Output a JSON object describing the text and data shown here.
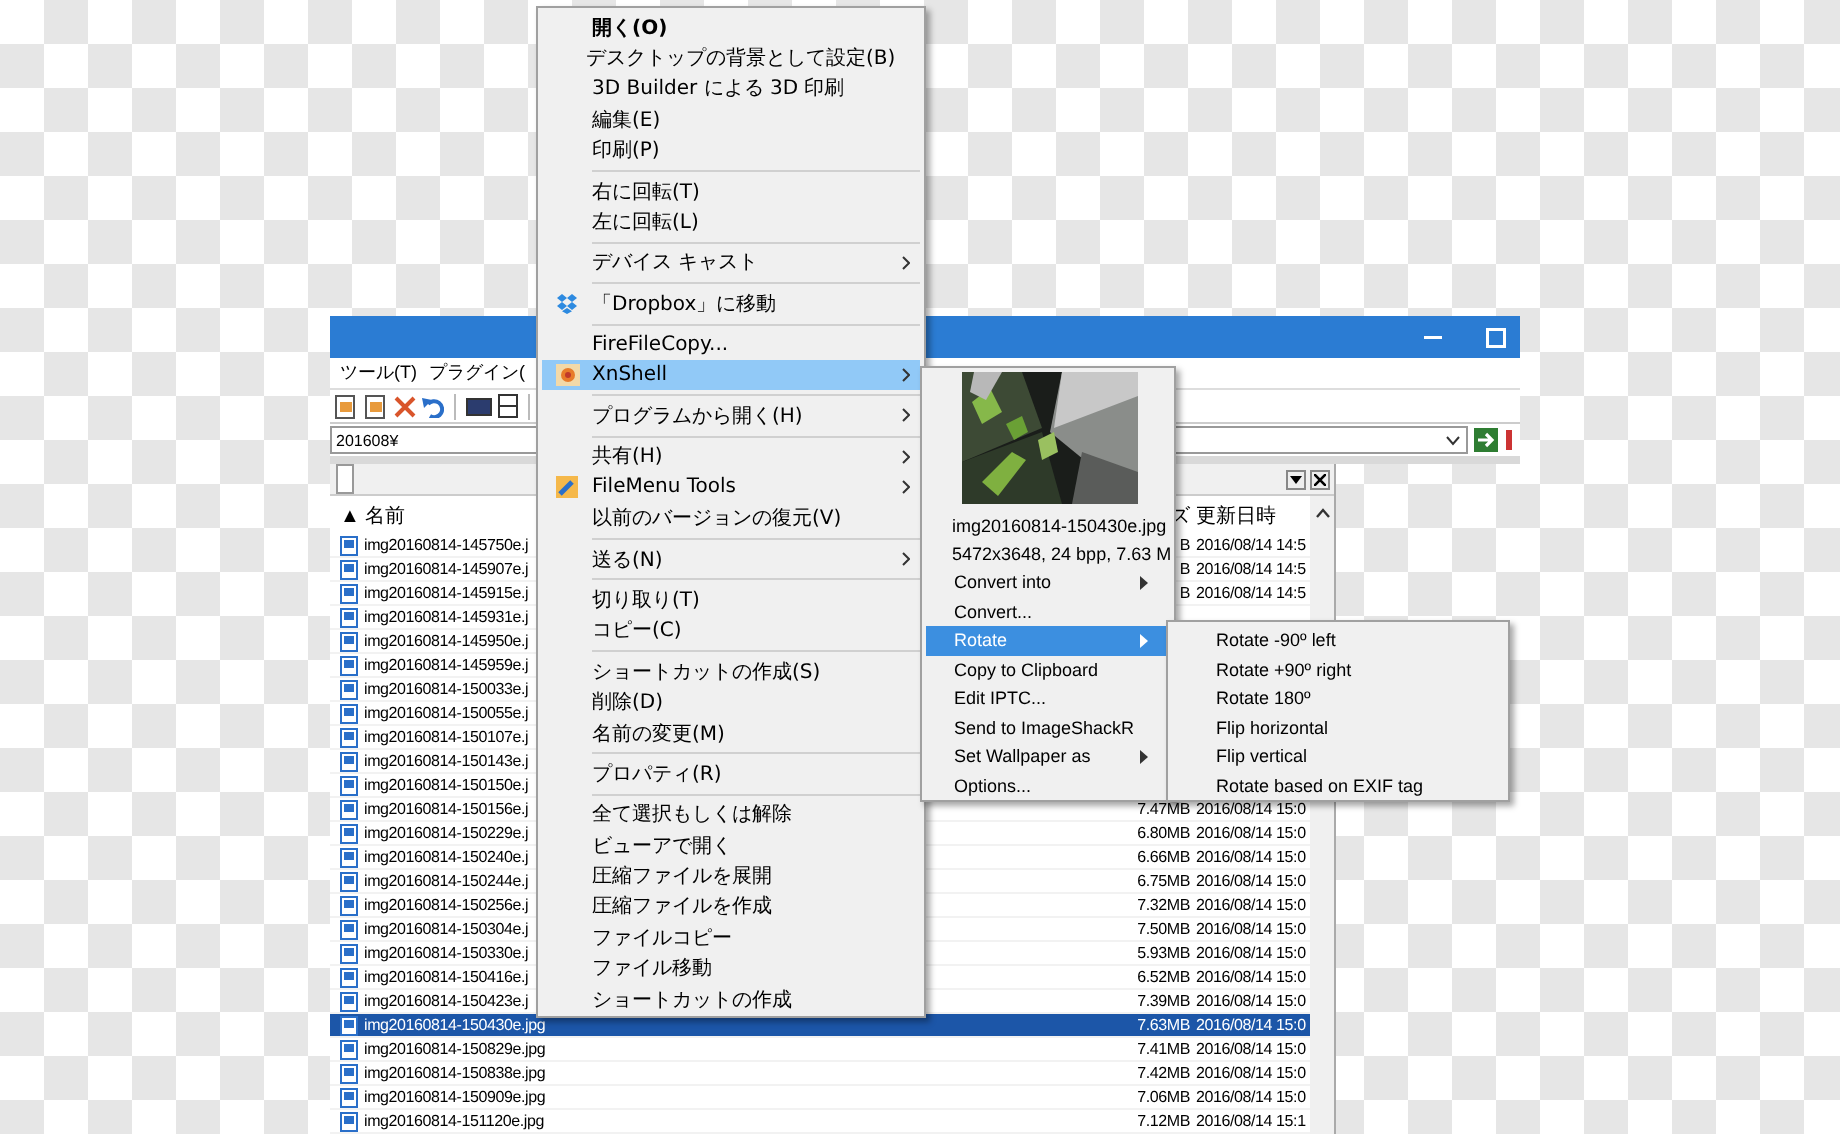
{
  "explorer": {
    "menu_bar": [
      "ツール(T)",
      "プラグイン("
    ],
    "address": "201608¥",
    "columns": {
      "sort_mark": "▲",
      "name": "名前",
      "size": "ズ",
      "modified": "更新日時"
    },
    "rows": [
      {
        "name": "img20160814-145750e.j",
        "size": "B",
        "modified": "2016/08/14 14:5",
        "selected": false
      },
      {
        "name": "img20160814-145907e.j",
        "size": "B",
        "modified": "2016/08/14 14:5",
        "selected": false
      },
      {
        "name": "img20160814-145915e.j",
        "size": "B",
        "modified": "2016/08/14 14:5",
        "selected": false
      },
      {
        "name": "img20160814-145931e.j",
        "selected": false
      },
      {
        "name": "img20160814-145950e.j",
        "selected": false
      },
      {
        "name": "img20160814-145959e.j",
        "selected": false
      },
      {
        "name": "img20160814-150033e.j",
        "selected": false
      },
      {
        "name": "img20160814-150055e.j",
        "selected": false
      },
      {
        "name": "img20160814-150107e.j",
        "selected": false
      },
      {
        "name": "img20160814-150143e.j",
        "selected": false
      },
      {
        "name": "img20160814-150150e.j",
        "selected": false
      },
      {
        "name": "img20160814-150156e.j",
        "size": "7.47MB",
        "modified": "2016/08/14 15:0",
        "selected": false
      },
      {
        "name": "img20160814-150229e.j",
        "size": "6.80MB",
        "modified": "2016/08/14 15:0",
        "selected": false
      },
      {
        "name": "img20160814-150240e.j",
        "size": "6.66MB",
        "modified": "2016/08/14 15:0",
        "selected": false
      },
      {
        "name": "img20160814-150244e.j",
        "size": "6.75MB",
        "modified": "2016/08/14 15:0",
        "selected": false
      },
      {
        "name": "img20160814-150256e.j",
        "size": "7.32MB",
        "modified": "2016/08/14 15:0",
        "selected": false
      },
      {
        "name": "img20160814-150304e.j",
        "size": "7.50MB",
        "modified": "2016/08/14 15:0",
        "selected": false
      },
      {
        "name": "img20160814-150330e.j",
        "size": "5.93MB",
        "modified": "2016/08/14 15:0",
        "selected": false
      },
      {
        "name": "img20160814-150416e.j",
        "size": "6.52MB",
        "modified": "2016/08/14 15:0",
        "selected": false
      },
      {
        "name": "img20160814-150423e.j",
        "size": "7.39MB",
        "modified": "2016/08/14 15:0",
        "selected": false
      },
      {
        "name": "img20160814-150430e.jpg",
        "size": "7.63MB",
        "modified": "2016/08/14 15:0",
        "selected": true
      },
      {
        "name": "img20160814-150829e.jpg",
        "size": "7.41MB",
        "modified": "2016/08/14 15:0",
        "selected": false
      },
      {
        "name": "img20160814-150838e.jpg",
        "size": "7.42MB",
        "modified": "2016/08/14 15:0",
        "selected": false
      },
      {
        "name": "img20160814-150909e.jpg",
        "size": "7.06MB",
        "modified": "2016/08/14 15:0",
        "selected": false
      },
      {
        "name": "img20160814-151120e.jpg",
        "size": "7.12MB",
        "modified": "2016/08/14 15:1",
        "selected": false
      }
    ]
  },
  "context_menu": {
    "items": [
      {
        "kind": "item",
        "label": "開く(O)",
        "bold": true,
        "submenu": false,
        "selected": false
      },
      {
        "kind": "item",
        "label": "デスクトップの背景として設定(B)",
        "bold": false,
        "submenu": false,
        "selected": false
      },
      {
        "kind": "item",
        "label": "3D Builder による 3D 印刷",
        "bold": false,
        "submenu": false,
        "selected": false
      },
      {
        "kind": "item",
        "label": "編集(E)",
        "bold": false,
        "submenu": false,
        "selected": false
      },
      {
        "kind": "item",
        "label": "印刷(P)",
        "bold": false,
        "submenu": false,
        "selected": false
      },
      {
        "kind": "separator"
      },
      {
        "kind": "item",
        "label": "右に回転(T)",
        "bold": false,
        "submenu": false,
        "selected": false
      },
      {
        "kind": "item",
        "label": "左に回転(L)",
        "bold": false,
        "submenu": false,
        "selected": false
      },
      {
        "kind": "separator"
      },
      {
        "kind": "item",
        "label": "デバイス キャスト",
        "bold": false,
        "submenu": true,
        "selected": false
      },
      {
        "kind": "separator"
      },
      {
        "kind": "item",
        "label": "「Dropbox」に移動",
        "bold": false,
        "submenu": false,
        "selected": false
      },
      {
        "kind": "separator"
      },
      {
        "kind": "item",
        "label": "FireFileCopy...",
        "bold": false,
        "submenu": false,
        "selected": false
      },
      {
        "kind": "item",
        "label": "XnShell",
        "bold": false,
        "submenu": true,
        "selected": true
      },
      {
        "kind": "separator"
      },
      {
        "kind": "item",
        "label": "プログラムから開く(H)",
        "bold": false,
        "submenu": true,
        "selected": false
      },
      {
        "kind": "separator"
      },
      {
        "kind": "item",
        "label": "共有(H)",
        "bold": false,
        "submenu": true,
        "selected": false
      },
      {
        "kind": "item",
        "label": "FileMenu Tools",
        "bold": false,
        "submenu": true,
        "selected": false
      },
      {
        "kind": "item",
        "label": "以前のバージョンの復元(V)",
        "bold": false,
        "submenu": false,
        "selected": false
      },
      {
        "kind": "separator"
      },
      {
        "kind": "item",
        "label": "送る(N)",
        "bold": false,
        "submenu": true,
        "selected": false
      },
      {
        "kind": "separator"
      },
      {
        "kind": "item",
        "label": "切り取り(T)",
        "bold": false,
        "submenu": false,
        "selected": false
      },
      {
        "kind": "item",
        "label": "コピー(C)",
        "bold": false,
        "submenu": false,
        "selected": false
      },
      {
        "kind": "separator"
      },
      {
        "kind": "item",
        "label": "ショートカットの作成(S)",
        "bold": false,
        "submenu": false,
        "selected": false
      },
      {
        "kind": "item",
        "label": "削除(D)",
        "bold": false,
        "submenu": false,
        "selected": false
      },
      {
        "kind": "item",
        "label": "名前の変更(M)",
        "bold": false,
        "submenu": false,
        "selected": false
      },
      {
        "kind": "separator"
      },
      {
        "kind": "item",
        "label": "プロパティ(R)",
        "bold": false,
        "submenu": false,
        "selected": false
      },
      {
        "kind": "separator"
      },
      {
        "kind": "item",
        "label": "全て選択もしくは解除",
        "bold": false,
        "submenu": false,
        "selected": false
      },
      {
        "kind": "item",
        "label": "ビューアで開く",
        "bold": false,
        "submenu": false,
        "selected": false
      },
      {
        "kind": "item",
        "label": "圧縮ファイルを展開",
        "bold": false,
        "submenu": false,
        "selected": false
      },
      {
        "kind": "item",
        "label": "圧縮ファイルを作成",
        "bold": false,
        "submenu": false,
        "selected": false
      },
      {
        "kind": "item",
        "label": "ファイルコピー",
        "bold": false,
        "submenu": false,
        "selected": false
      },
      {
        "kind": "item",
        "label": "ファイル移動",
        "bold": false,
        "submenu": false,
        "selected": false
      },
      {
        "kind": "item",
        "label": "ショートカットの作成",
        "bold": false,
        "submenu": false,
        "selected": false
      }
    ]
  },
  "xnshell_menu": {
    "file_name": "img20160814-150430e.jpg",
    "file_info": "5472x3648, 24 bpp, 7.63 M",
    "items": [
      {
        "label": "Convert into",
        "submenu": true,
        "selected": false
      },
      {
        "label": "Convert...",
        "submenu": false,
        "selected": false
      },
      {
        "label": "Rotate",
        "submenu": true,
        "selected": true
      },
      {
        "label": "Copy to Clipboard",
        "submenu": false,
        "selected": false
      },
      {
        "label": "Edit IPTC...",
        "submenu": false,
        "selected": false
      },
      {
        "label": "Send to ImageShackR",
        "submenu": false,
        "selected": false
      },
      {
        "label": "Set Wallpaper as",
        "submenu": true,
        "selected": false
      },
      {
        "label": "Options...",
        "submenu": false,
        "selected": false
      }
    ]
  },
  "rotate_menu": {
    "items": [
      "Rotate -90º left",
      "Rotate +90º right",
      "Rotate 180º",
      "Flip horizontal",
      "Flip vertical",
      "Rotate based on EXIF tag"
    ]
  }
}
